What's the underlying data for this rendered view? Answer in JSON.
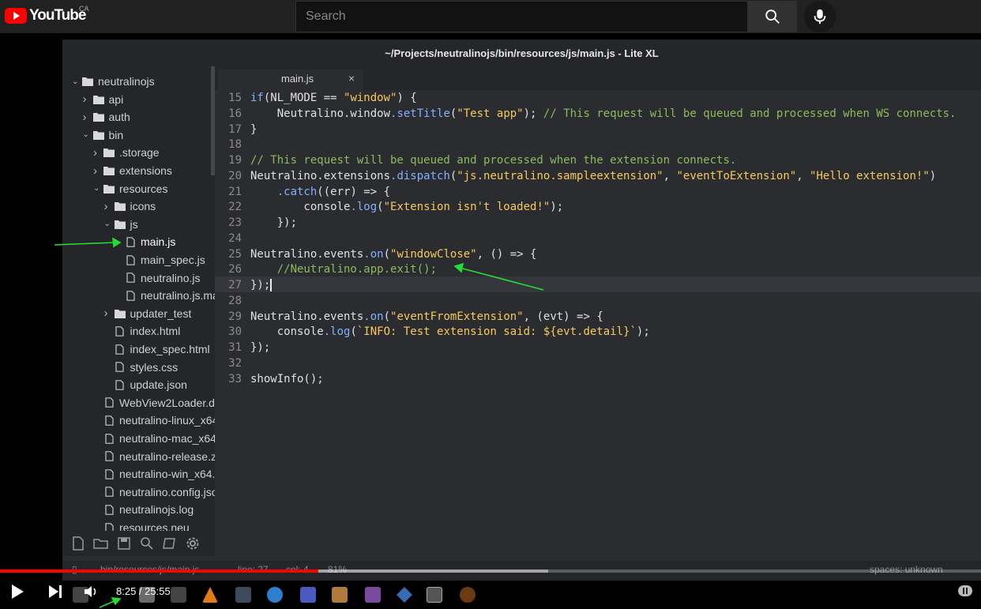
{
  "youtube": {
    "logo_text": "YouTube",
    "region": "CA",
    "search_placeholder": "Search"
  },
  "window": {
    "title": "~/Projects/neutralinojs/bin/resources/js/main.js - Lite XL"
  },
  "sidebar": {
    "items": [
      {
        "label": "neutralinojs",
        "type": "folder",
        "expanded": true,
        "level": 0
      },
      {
        "label": "api",
        "type": "folder",
        "expanded": false,
        "level": 1
      },
      {
        "label": "auth",
        "type": "folder",
        "expanded": false,
        "level": 1
      },
      {
        "label": "bin",
        "type": "folder",
        "expanded": true,
        "level": 1
      },
      {
        "label": ".storage",
        "type": "folder",
        "expanded": false,
        "level": 2
      },
      {
        "label": "extensions",
        "type": "folder",
        "expanded": false,
        "level": 2
      },
      {
        "label": "resources",
        "type": "folder",
        "expanded": true,
        "level": 2
      },
      {
        "label": "icons",
        "type": "folder",
        "expanded": false,
        "level": 3
      },
      {
        "label": "js",
        "type": "folder",
        "expanded": true,
        "level": 3
      },
      {
        "label": "main.js",
        "type": "file",
        "level": 4,
        "active": true
      },
      {
        "label": "main_spec.js",
        "type": "file",
        "level": 4
      },
      {
        "label": "neutralino.js",
        "type": "file",
        "level": 4
      },
      {
        "label": "neutralino.js.ma",
        "type": "file",
        "level": 4
      },
      {
        "label": "updater_test",
        "type": "folder",
        "expanded": false,
        "level": 3
      },
      {
        "label": "index.html",
        "type": "file",
        "level": 3
      },
      {
        "label": "index_spec.html",
        "type": "file",
        "level": 3
      },
      {
        "label": "styles.css",
        "type": "file",
        "level": 3
      },
      {
        "label": "update.json",
        "type": "file",
        "level": 3
      },
      {
        "label": "WebView2Loader.dll",
        "type": "file",
        "level": 2
      },
      {
        "label": "neutralino-linux_x64",
        "type": "file",
        "level": 2
      },
      {
        "label": "neutralino-mac_x64",
        "type": "file",
        "level": 2
      },
      {
        "label": "neutralino-release.zi",
        "type": "file",
        "level": 2
      },
      {
        "label": "neutralino-win_x64.e",
        "type": "file",
        "level": 2
      },
      {
        "label": "neutralino.config.jso",
        "type": "file",
        "level": 2
      },
      {
        "label": "neutralinojs.log",
        "type": "file",
        "level": 2
      },
      {
        "label": "resources.neu",
        "type": "file",
        "level": 2
      }
    ]
  },
  "tab": {
    "name": "main.js",
    "close": "×"
  },
  "code": {
    "lines": [
      {
        "no": "15",
        "text": "if(NL_MODE == \"window\") {"
      },
      {
        "no": "16",
        "text": "    Neutralino.window.setTitle(\"Test app\"); // This request will be queued and processed when WS connects."
      },
      {
        "no": "17",
        "text": "}"
      },
      {
        "no": "18",
        "text": ""
      },
      {
        "no": "19",
        "text": "// This request will be queued and processed when the extension connects."
      },
      {
        "no": "20",
        "text": "Neutralino.extensions.dispatch(\"js.neutralino.sampleextension\", \"eventToExtension\", \"Hello extension!\")"
      },
      {
        "no": "21",
        "text": "    .catch((err) => {"
      },
      {
        "no": "22",
        "text": "        console.log(\"Extension isn't loaded!\");"
      },
      {
        "no": "23",
        "text": "    });"
      },
      {
        "no": "24",
        "text": ""
      },
      {
        "no": "25",
        "text": "Neutralino.events.on(\"windowClose\", () => {"
      },
      {
        "no": "26",
        "text": "    //Neutralino.app.exit();"
      },
      {
        "no": "27",
        "text": "});"
      },
      {
        "no": "28",
        "text": ""
      },
      {
        "no": "29",
        "text": "Neutralino.events.on(\"eventFromExtension\", (evt) => {"
      },
      {
        "no": "30",
        "text": "    console.log(`INFO: Test extension said: ${evt.detail}`);"
      },
      {
        "no": "31",
        "text": "});"
      },
      {
        "no": "32",
        "text": ""
      },
      {
        "no": "33",
        "text": "showInfo();"
      }
    ]
  },
  "status": {
    "path": "bin/resources/js/main.js",
    "line": "line: 27",
    "col": "col: 4",
    "percent": "81%",
    "spaces": "spaces: unknown"
  },
  "player": {
    "time": "8:25 / 25:55",
    "played_fraction": 0.3248,
    "loaded_fraction": 0.5588
  },
  "colors": {
    "yt_red": "#ff0000",
    "arrow_green": "#22dd33",
    "keyword": "#82b1ff",
    "string": "#f7c95c",
    "comment": "#8dbb5b"
  }
}
